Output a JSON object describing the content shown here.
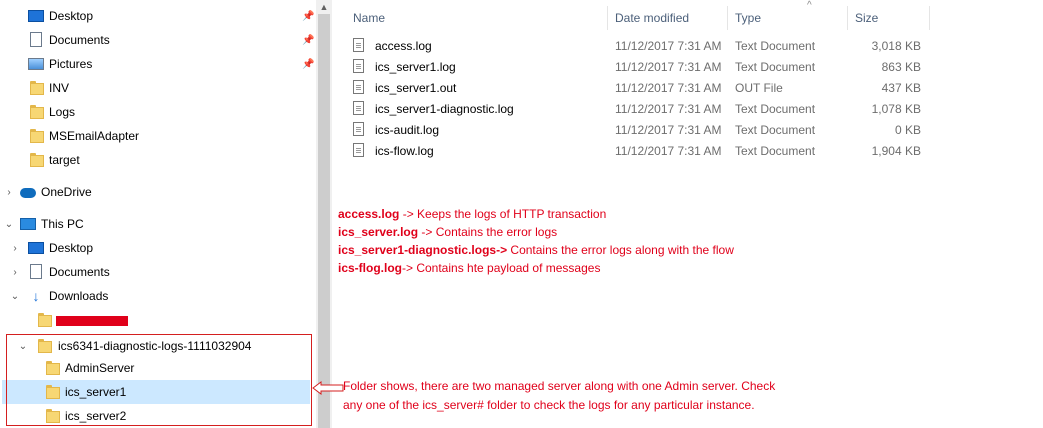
{
  "nav": {
    "quick_access": [
      {
        "label": "Desktop",
        "icon": "desktop-icon",
        "pinned": true
      },
      {
        "label": "Documents",
        "icon": "documents-icon",
        "pinned": true
      },
      {
        "label": "Pictures",
        "icon": "pictures-icon",
        "pinned": true
      },
      {
        "label": "INV",
        "icon": "folder-icon"
      },
      {
        "label": "Logs",
        "icon": "folder-icon"
      },
      {
        "label": "MSEmailAdapter",
        "icon": "folder-icon"
      },
      {
        "label": "target",
        "icon": "folder-icon"
      }
    ],
    "onedrive": "OneDrive",
    "this_pc": "This PC",
    "pc_items": [
      {
        "label": "Desktop",
        "icon": "desktop-icon"
      },
      {
        "label": "Documents",
        "icon": "documents-icon"
      },
      {
        "label": "Downloads",
        "icon": "downloads-icon"
      }
    ],
    "diag_folder": "ics6341-diagnostic-logs-1111032904",
    "subfolders": [
      {
        "label": "AdminServer"
      },
      {
        "label": "ics_server1",
        "selected": true
      },
      {
        "label": "ics_server2"
      }
    ]
  },
  "columns": {
    "name": "Name",
    "date": "Date modified",
    "type": "Type",
    "size": "Size"
  },
  "files": [
    {
      "name": "access.log",
      "date": "11/12/2017 7:31 AM",
      "type": "Text Document",
      "size": "3,018 KB"
    },
    {
      "name": "ics_server1.log",
      "date": "11/12/2017 7:31 AM",
      "type": "Text Document",
      "size": "863 KB"
    },
    {
      "name": "ics_server1.out",
      "date": "11/12/2017 7:31 AM",
      "type": "OUT File",
      "size": "437 KB"
    },
    {
      "name": "ics_server1-diagnostic.log",
      "date": "11/12/2017 7:31 AM",
      "type": "Text Document",
      "size": "1,078 KB"
    },
    {
      "name": "ics-audit.log",
      "date": "11/12/2017 7:31 AM",
      "type": "Text Document",
      "size": "0 KB"
    },
    {
      "name": "ics-flow.log",
      "date": "11/12/2017 7:31 AM",
      "type": "Text Document",
      "size": "1,904 KB"
    }
  ],
  "annotations": {
    "lines": [
      {
        "bold": "access.log",
        "text": " -> Keeps the logs of HTTP transaction"
      },
      {
        "bold": "ics_server.log",
        "text": " -> Contains the error logs"
      },
      {
        "bold": "ics_server1-diagnostic.logs->",
        "text": " Contains the error logs along with the flow"
      },
      {
        "bold": "ics-flog.log",
        "text": "-> Contains hte payload of messages"
      }
    ],
    "folder_note_1": "Folder shows, there are two managed server along with one Admin server. Check",
    "folder_note_2": "any one of the ics_server# folder to check the logs for any particular instance."
  },
  "colors": {
    "accent_red": "#e0001a",
    "selection": "#cce8ff",
    "folder": "#f7d774"
  }
}
